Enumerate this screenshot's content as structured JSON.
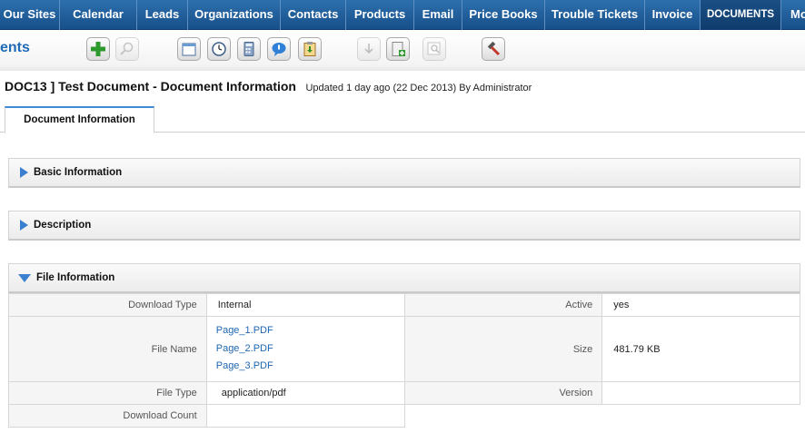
{
  "nav": {
    "items": [
      "Our Sites",
      "Calendar",
      "Leads",
      "Organizations",
      "Contacts",
      "Products",
      "Email",
      "Price Books",
      "Trouble Tickets",
      "Invoice",
      "DOCUMENTS",
      "Mo"
    ],
    "active": "DOCUMENTS"
  },
  "toolbar": {
    "module_title": "ents",
    "icons": [
      "add-icon",
      "search-icon",
      "calendar-icon",
      "clock-icon",
      "calculator-icon",
      "chat-icon",
      "clipboard-icon",
      "import-icon",
      "export-icon",
      "find-duplicates-icon",
      "settings-hammer-icon"
    ]
  },
  "header": {
    "title": "DOC13 ] Test Document - Document Information",
    "updated": "Updated 1 day ago (22 Dec 2013) By Administrator"
  },
  "tabs": [
    {
      "label": "Document Information"
    }
  ],
  "blocks": {
    "basic": "Basic Information",
    "description": "Description",
    "file": "File Information"
  },
  "file_info": {
    "download_type_label": "Download Type",
    "download_type": "Internal",
    "active_label": "Active",
    "active": "yes",
    "file_name_label": "File Name",
    "files": [
      "Page_1.PDF",
      "Page_2.PDF",
      "Page_3.PDF"
    ],
    "size_label": "Size",
    "size": "481.79 KB",
    "file_type_label": "File Type",
    "file_type": "application/pdf",
    "version_label": "Version",
    "version": "",
    "download_count_label": "Download Count",
    "download_count": ""
  },
  "colors": {
    "nav_bg": "#1e5a96",
    "link": "#1e66b2",
    "accent_triangle": "#3b7fcf"
  }
}
